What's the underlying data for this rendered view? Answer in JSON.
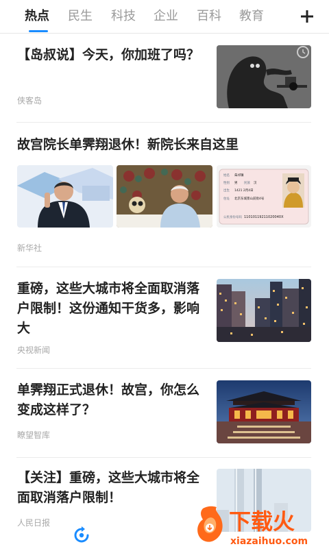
{
  "tabs": [
    {
      "label": "热点",
      "active": true
    },
    {
      "label": "民生"
    },
    {
      "label": "科技"
    },
    {
      "label": "企业"
    },
    {
      "label": "百科"
    },
    {
      "label": "教育"
    }
  ],
  "add_channel_icon": "plus-icon",
  "accent_color": "#1a8cff",
  "articles": [
    {
      "title": "【岛叔说】今天，你加班了吗？",
      "source": "侠客岛"
    },
    {
      "title": "故宫院长单霁翔退休！新院长来自这里",
      "source": "新华社"
    },
    {
      "title": "重磅，这些大城市将全面取消落户限制！这份通知干货多，影响大",
      "source": "央视新闻"
    },
    {
      "title": "单霁翔正式退休！故宫，你怎么变成这样了？",
      "source": "瞭望智库"
    },
    {
      "title": "【关注】重磅，这些大城市将全面取消落户限制！",
      "source": "人民日报"
    }
  ],
  "id_card": {
    "name_label": "姓名",
    "name_value": "朱祁镇",
    "sex_label": "性别",
    "sex_value": "男",
    "ethnic_label": "民族",
    "ethnic_value": "汉",
    "birth_label": "出生",
    "birth_value": "1421 2月4日",
    "address_label": "住址",
    "address_value": "北京东城景山前街4号",
    "id_label": "公民身份号码",
    "id_value": "11010119211020040X"
  },
  "watermark": {
    "brand": "下载火",
    "url": "xiazaihuo.com"
  }
}
